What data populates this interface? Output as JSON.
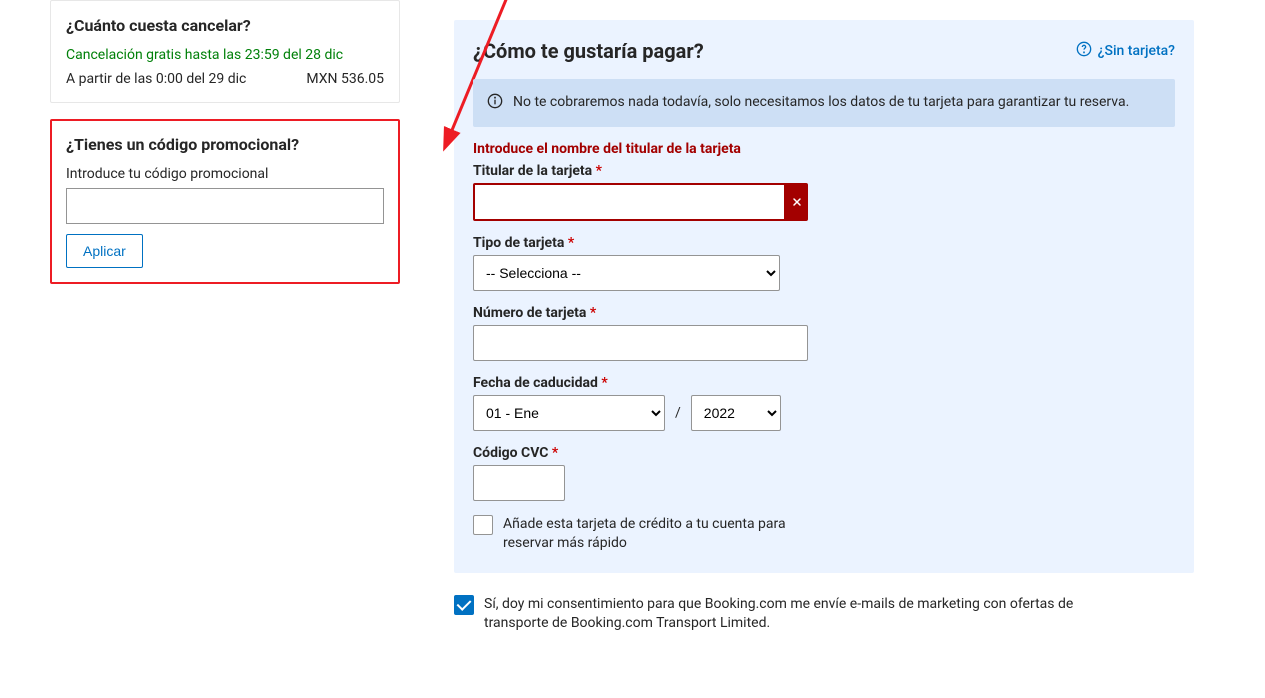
{
  "cancel_box": {
    "title": "¿Cuánto cuesta cancelar?",
    "free_text": "Cancelación gratis hasta las 23:59 del 28 dic",
    "fee_text": "A partir de las 0:00 del 29 dic",
    "fee_amount": "MXN 536.05"
  },
  "promo_box": {
    "title": "¿Tienes un código promocional?",
    "label": "Introduce tu código promocional",
    "apply": "Aplicar"
  },
  "pay": {
    "title": "¿Cómo te gustaría pagar?",
    "no_card": "¿Sin tarjeta?",
    "info": "No te cobraremos nada todavía, solo necesitamos los datos de tu tarjeta para garantizar tu reserva.",
    "error_holder": "Introduce el nombre del titular de la tarjeta",
    "holder_label": "Titular de la tarjeta",
    "type_label": "Tipo de tarjeta",
    "type_placeholder": "-- Selecciona --",
    "number_label": "Número de tarjeta",
    "expiry_label": "Fecha de caducidad",
    "expiry_month": "01 - Ene",
    "expiry_year": "2022",
    "cvc_label": "Código CVC",
    "save_card_label": "Añade esta tarjeta de crédito a tu cuenta para reservar más rápido"
  },
  "consent": {
    "label": "Sí, doy mi consentimiento para que Booking.com me envíe e-mails de marketing con ofertas de transporte de Booking.com Transport Limited."
  }
}
